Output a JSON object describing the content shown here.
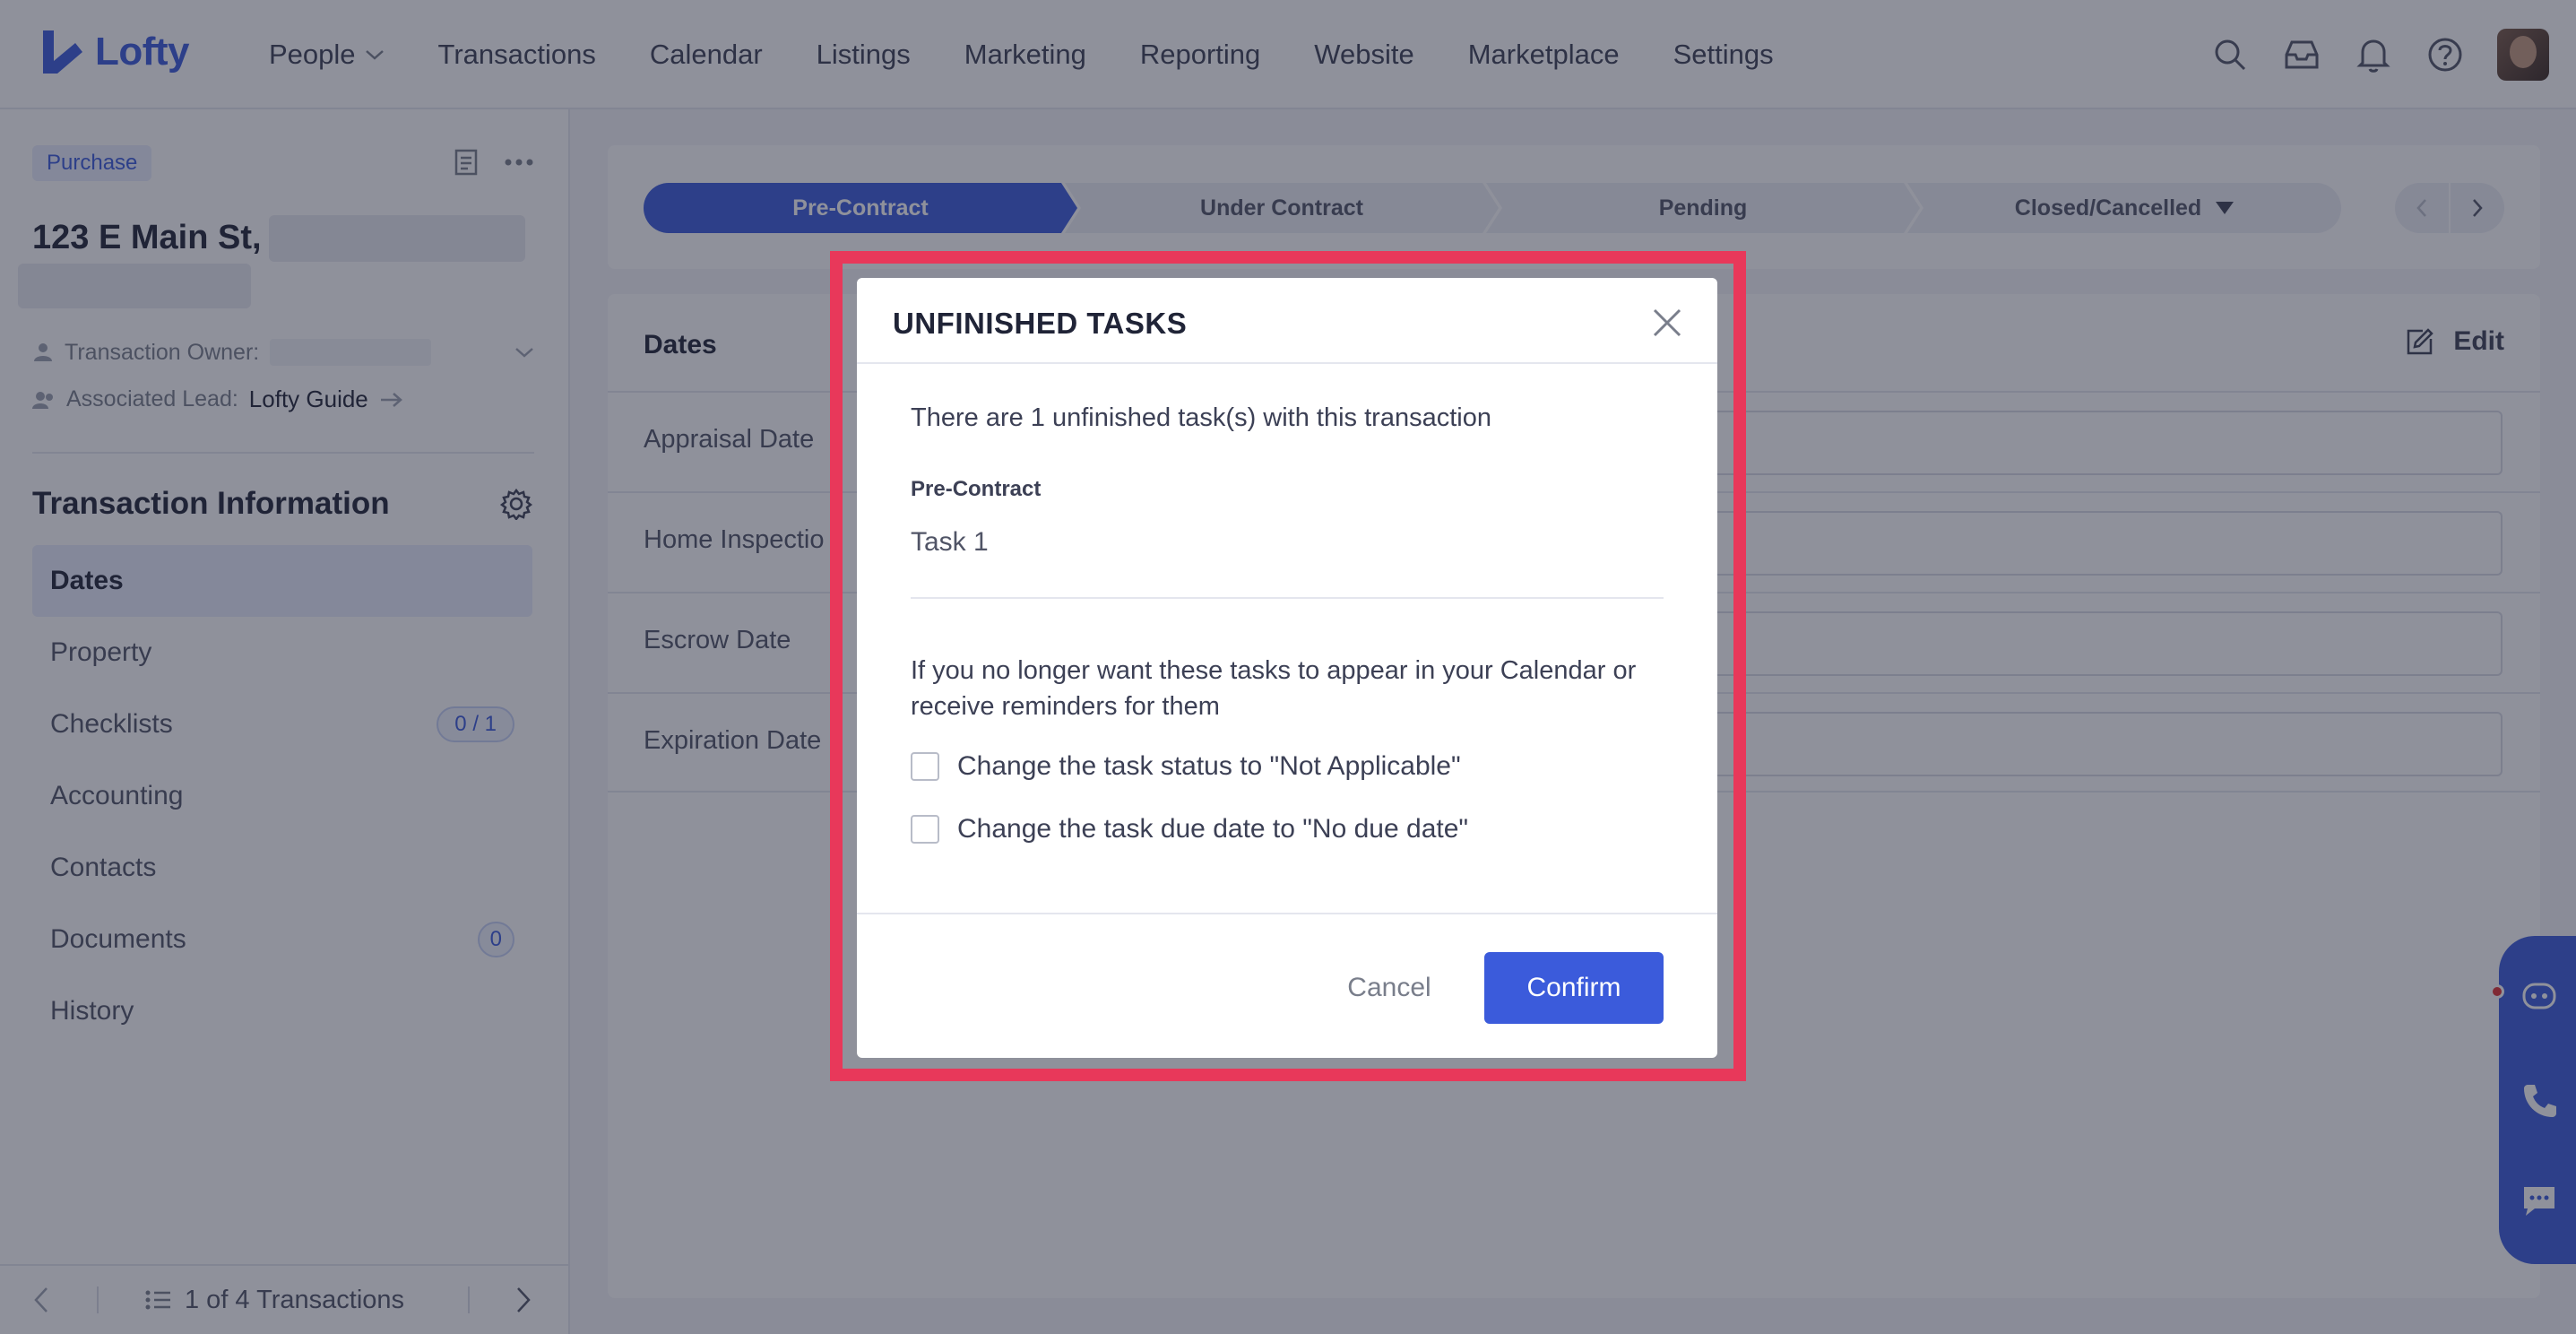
{
  "brand": {
    "name": "Lofty",
    "accent": "#3b5bdb",
    "highlight": "#e8385a"
  },
  "nav": {
    "items": [
      {
        "label": "People",
        "has_dropdown": true
      },
      {
        "label": "Transactions"
      },
      {
        "label": "Calendar"
      },
      {
        "label": "Listings"
      },
      {
        "label": "Marketing"
      },
      {
        "label": "Reporting"
      },
      {
        "label": "Website"
      },
      {
        "label": "Marketplace"
      },
      {
        "label": "Settings"
      }
    ],
    "icons": [
      "search-icon",
      "inbox-icon",
      "bell-icon",
      "help-icon",
      "avatar"
    ]
  },
  "sidebar": {
    "tag": "Purchase",
    "address": "123 E Main St,",
    "owner_label": "Transaction Owner:",
    "lead_label": "Associated Lead:",
    "lead_value": "Lofty Guide",
    "section_title": "Transaction Information",
    "menu": [
      {
        "label": "Dates",
        "active": true
      },
      {
        "label": "Property"
      },
      {
        "label": "Checklists",
        "badge": "0 / 1"
      },
      {
        "label": "Accounting"
      },
      {
        "label": "Contacts"
      },
      {
        "label": "Documents",
        "badge": "0"
      },
      {
        "label": "History"
      }
    ],
    "pager": "1 of 4 Transactions"
  },
  "stages": {
    "items": [
      {
        "label": "Pre-Contract",
        "active": true
      },
      {
        "label": "Under Contract"
      },
      {
        "label": "Pending"
      },
      {
        "label": "Closed/Cancelled",
        "has_dropdown": true
      }
    ]
  },
  "dates": {
    "title": "Dates",
    "edit_label": "Edit",
    "rows": [
      {
        "label": "Appraisal Date"
      },
      {
        "label": "Home Inspectio"
      },
      {
        "label": "Escrow Date"
      },
      {
        "label": "Expiration Date"
      }
    ]
  },
  "modal": {
    "title": "UNFINISHED TASKS",
    "intro": "There are 1 unfinished task(s) with this transaction",
    "stage_label": "Pre-Contract",
    "task": "Task 1",
    "note": "If you no longer want these tasks to appear in your Calendar or receive reminders for them",
    "option1": "Change the task status to \"Not Applicable\"",
    "option2": "Change the task due date to \"No due date\"",
    "cancel": "Cancel",
    "confirm": "Confirm"
  }
}
